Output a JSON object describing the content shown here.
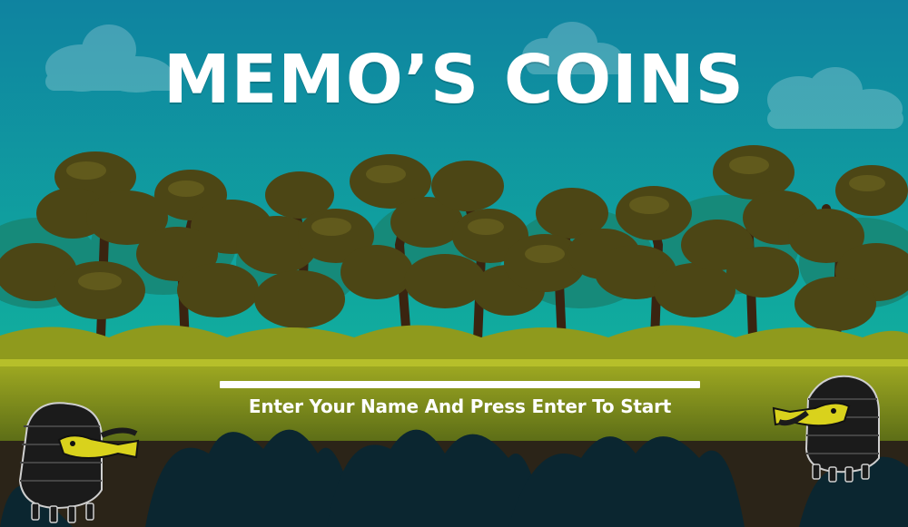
{
  "game": {
    "title": "MEMO’S COINS",
    "start_prompt": "Enter Your Name And Press Enter To Start",
    "name_input_value": ""
  },
  "colors": {
    "sky_top": "#118a9c",
    "sky_bottom": "#0fb39a",
    "foliage": "#4e4a16",
    "grass": "#93a21f",
    "ground_dark": "#2b2418",
    "foreground_bush": "#0b2630",
    "character_body": "#1b1b1b",
    "character_beak": "#d9d21c",
    "title_text": "#ffffff"
  },
  "characters": [
    {
      "name": "ninja-doodler-left",
      "facing": "right"
    },
    {
      "name": "ninja-doodler-right",
      "facing": "left"
    }
  ]
}
